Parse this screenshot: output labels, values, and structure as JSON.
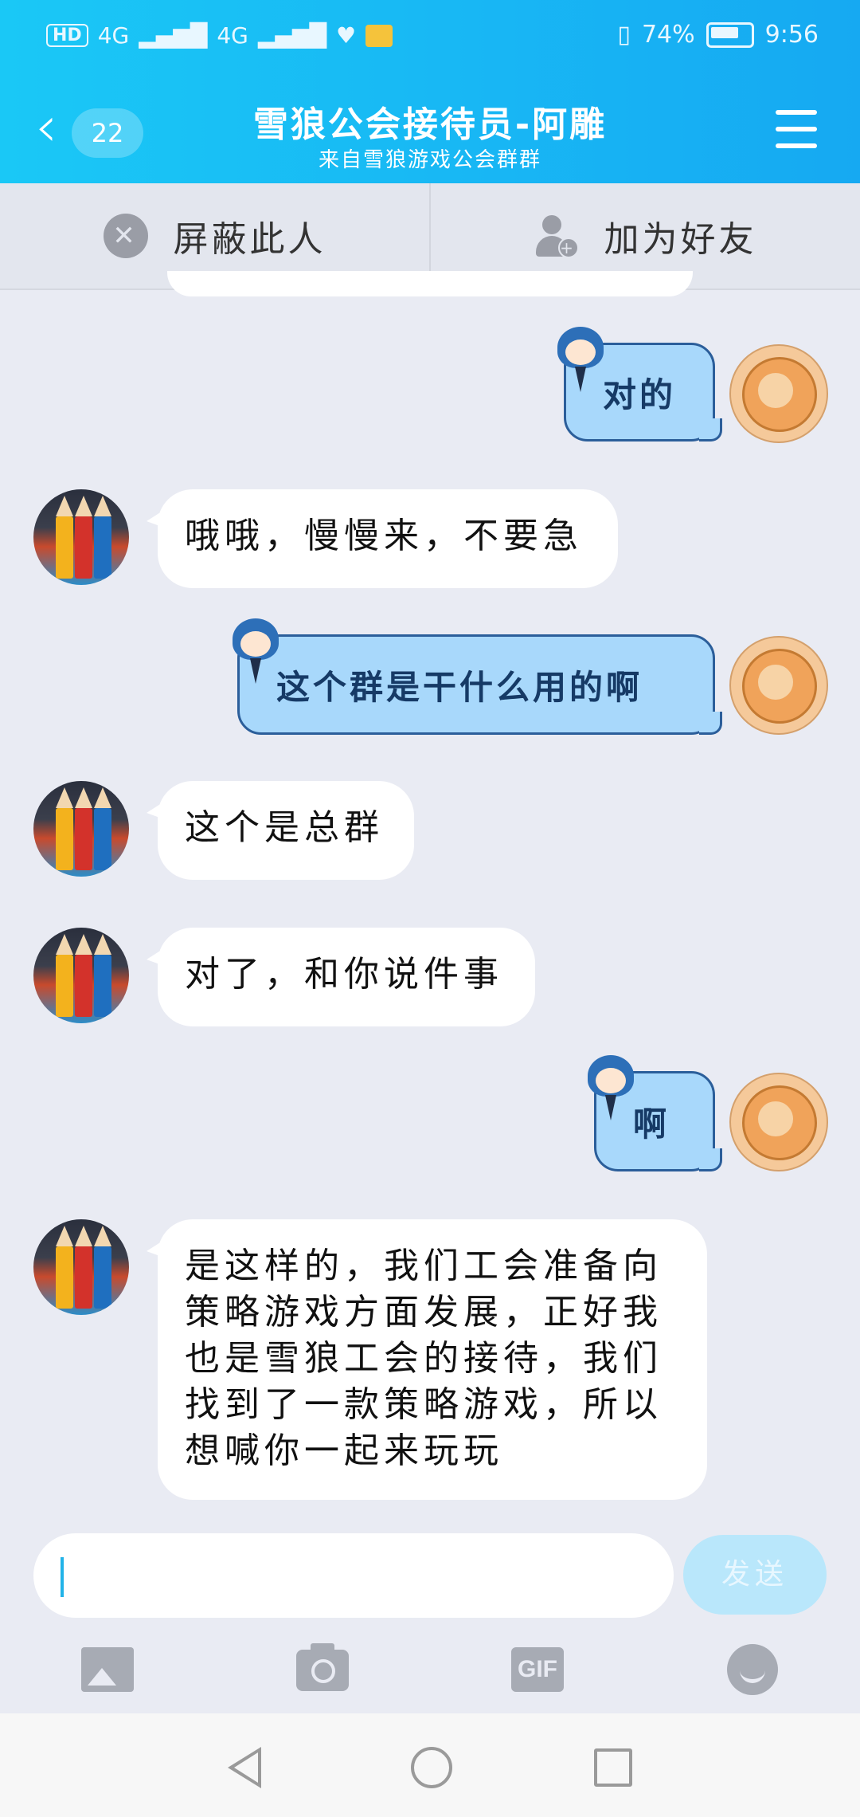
{
  "status_bar": {
    "network": "HD",
    "signal1": "4G",
    "signal2": "4G",
    "battery_text": "74%",
    "time": "9:56"
  },
  "header": {
    "unread_count": "22",
    "title": "雪狼公会接待员-阿雕",
    "subtitle": "来自雪狼游戏公会群群"
  },
  "actions": {
    "block_label": "屏蔽此人",
    "add_friend_label": "加为好友"
  },
  "messages": [
    {
      "side": "out",
      "text": "对的"
    },
    {
      "side": "in",
      "text": "哦哦，慢慢来，不要急"
    },
    {
      "side": "out",
      "text": "这个群是干什么用的啊"
    },
    {
      "side": "in",
      "text": "这个是总群"
    },
    {
      "side": "in",
      "text": "对了，和你说件事"
    },
    {
      "side": "out",
      "text": "啊"
    },
    {
      "side": "in",
      "text": "是这样的，我们工会准备向策略游戏方面发展，正好我也是雪狼工会的接待，我们找到了一款策略游戏，所以想喊你一起来玩玩"
    }
  ],
  "input": {
    "value": "",
    "send_label": "发送"
  },
  "toolbar": {
    "items": [
      "image-icon",
      "camera-icon",
      "gif-icon",
      "emoji-icon"
    ],
    "gif_label": "GIF"
  },
  "navigation": [
    "back-icon",
    "home-icon",
    "recent-apps-icon"
  ],
  "colors": {
    "header": "#16a9f2",
    "background": "#e9ebf3",
    "outgoing_bubble": "#a8d8fb",
    "send_button": "#b9e7fb"
  }
}
